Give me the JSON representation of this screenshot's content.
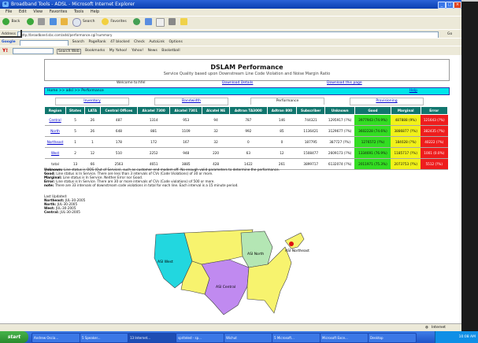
{
  "browser": {
    "title": "Broadband Tools - ADSL - Microsoft Internet Explorer",
    "menu": [
      "File",
      "Edit",
      "View",
      "Favorites",
      "Tools",
      "Help"
    ],
    "toolbar1": {
      "back": "Back",
      "search": "Search",
      "favorites": "Favorites"
    },
    "address_label": "Address",
    "address": "http://broadband.sbc.com/adsl/performance.cgi?summary",
    "go": "Go",
    "links": "Links",
    "google_label": "Google",
    "search_label": "Search",
    "pagerank": "PageRank",
    "blocked": "47 blocked",
    "check": "Check",
    "autolink": "AutoLink",
    "options": "Options",
    "yahoo": "Y!",
    "search_web": "Search Web",
    "bookmarks": "Bookmarks",
    "my_yahoo": "My Yahoo!",
    "yahoo_link": "Yahoo!",
    "news": "News",
    "basketball": "Basketball",
    "status_text": "",
    "status_zone": "Internet"
  },
  "page": {
    "title": "DSLAM Performance",
    "subtitle": "Service Quality based upon Downstream Line Code Violation and Noise Margin Ratio",
    "welcome": "Welcome to:hfel",
    "download_details": "Download Details",
    "download_page": "Download this page",
    "breadcrumb": "Home >> adsl >> Performance",
    "help": "Help",
    "tabs": [
      {
        "label": "Inventory",
        "active": false
      },
      {
        "label": "Bandwidth",
        "active": false
      },
      {
        "label": "Performance",
        "active": true
      },
      {
        "label": "Provisioning",
        "active": false
      }
    ],
    "table": {
      "headers": [
        "Region",
        "States",
        "LATA",
        "Central Offices",
        "Alcatel 7300",
        "Alcatel 7301",
        "Alcatel NE",
        "Adtran TA3000",
        "Adtran 800",
        "Subscriber",
        "Unknown",
        "Good",
        "Marginal",
        "Error"
      ],
      "rows": [
        [
          "Central",
          "5",
          "26",
          "487",
          "1314",
          "953",
          "94",
          "787",
          "146",
          "744321",
          "1295917 (?%)",
          "3977943 (74.9%)",
          "487888 (9%)",
          "121643 (?%)"
        ],
        [
          "North",
          "5",
          "26",
          "648",
          "881",
          "1109",
          "32",
          "992",
          "85",
          "1136421",
          "3129677 (?%)",
          "3602228 (74.6%)",
          "3886877 (?%)",
          "382435 (?%)"
        ],
        [
          "Northeast",
          "1",
          "1",
          "178",
          "172",
          "167",
          "32",
          "0",
          "0",
          "187795",
          "387727 (?%)",
          "1276572 (?%)",
          "184028 (?%)",
          "40222 (?%)"
        ],
        [
          "West",
          "2",
          "12",
          "510",
          "2252",
          "948",
          "220",
          "63",
          "12",
          "1508477",
          "2609173 (?%)",
          "1334691 (76.9%)",
          "1185717 (?%)",
          "1001 (0.0%)"
        ],
        [
          "total",
          "13",
          "66",
          "2563",
          "4651",
          "3885",
          "428",
          "1422",
          "261",
          "3899717",
          "6132074 (?%)",
          "2011971 (75.3%)",
          "2073753 (?%)",
          "5512 (?%)"
        ]
      ],
      "link_rows": [
        0,
        1,
        2,
        3
      ]
    },
    "legend": [
      {
        "term": "Unknown:",
        "text": "Line status is OOS (Out of Service), such as customer end modem off. No enough valid parameters to determine the performance."
      },
      {
        "term": "Good:",
        "text": "Line status is In Service. There are less than 3 intervals of CVs (Code Violations) of 30 or more."
      },
      {
        "term": "Marginal:",
        "text": "Line status is In Service. Neither Error nor Good."
      },
      {
        "term": "Error:",
        "text": "Line status is In Service. There are 30 or more intervals of CVs (Code violations) of 500 or more."
      },
      {
        "term": "note:",
        "text": "There are 33 intervals of downstream code violations in total for each line. Each interval is a 15 minute period."
      }
    ],
    "last_updated_label": "Last Updated:",
    "last_updated": [
      {
        "region": "Northeast:",
        "date": "JUL-30-2005"
      },
      {
        "region": "North:",
        "date": "JUL-30-2005"
      },
      {
        "region": "West:",
        "date": "JUL-30-2005"
      },
      {
        "region": "Central:",
        "date": "JUL-30-2005"
      }
    ],
    "map_labels": {
      "west": "ASI West",
      "north": "ASI North",
      "central": "ASI Central",
      "northeast": "ASI Northeast"
    }
  },
  "colors": {
    "header_teal": "#11766e",
    "good": "#33dd22",
    "marginal": "#f2f21a",
    "error": "#ee1d1d",
    "breadcrumb_cyan": "#00e5ea",
    "region_west": "#22d7df",
    "region_north": "#b4e6b4",
    "region_central": "#c08af0",
    "region_default": "#f7f36e"
  },
  "taskbar": {
    "start": "start",
    "tasks": [
      "Andrew Oscia...",
      "5 Speaker...",
      "13 Internet...",
      "spriteled - sp...",
      "Wichut",
      "5 Microsoft...",
      "Microsoft Exce...",
      "Desktop"
    ],
    "active_task": 2,
    "clock": "10:08 AM"
  }
}
